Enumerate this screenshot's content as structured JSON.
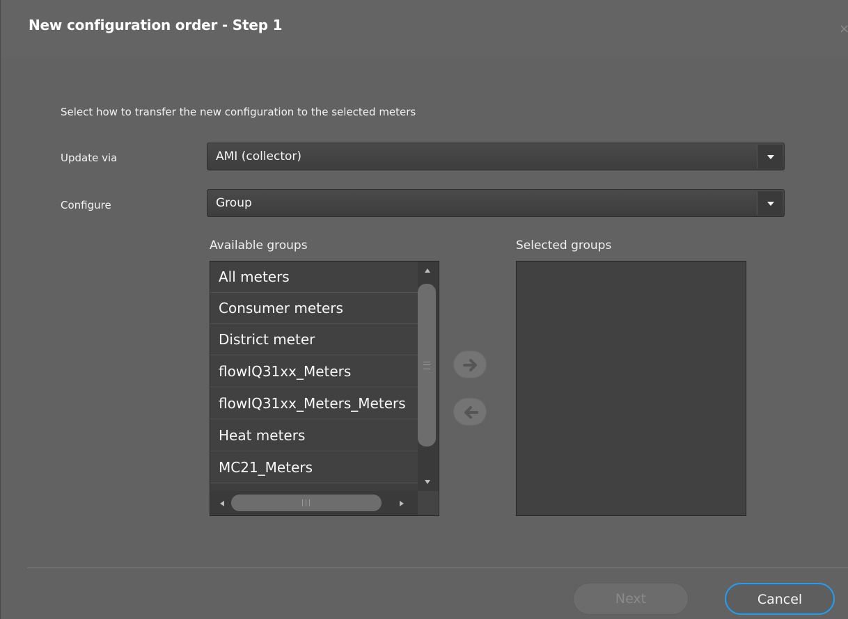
{
  "dialog": {
    "title": "New configuration order - Step 1",
    "close_glyph": "×",
    "instruction": "Select how to transfer the new configuration to the selected meters"
  },
  "update_via": {
    "label": "Update via",
    "selected": "AMI (collector)"
  },
  "configure": {
    "label": "Configure",
    "selected": "Group"
  },
  "available_groups": {
    "label": "Available groups",
    "items": [
      "All meters",
      "Consumer meters",
      "District meter",
      "flowIQ31xx_Meters",
      "flowIQ31xx_Meters_Meters",
      "Heat meters",
      "MC21_Meters"
    ]
  },
  "selected_groups": {
    "label": "Selected groups",
    "items": []
  },
  "transfer": {
    "add_icon": "arrow-right-icon",
    "remove_icon": "arrow-left-icon"
  },
  "footer": {
    "next_label": "Next",
    "cancel_label": "Cancel"
  },
  "colors": {
    "background": "#626262",
    "list_background": "#414141",
    "focus_ring": "#3c95d4",
    "disabled_text": "#8a8a8a"
  }
}
